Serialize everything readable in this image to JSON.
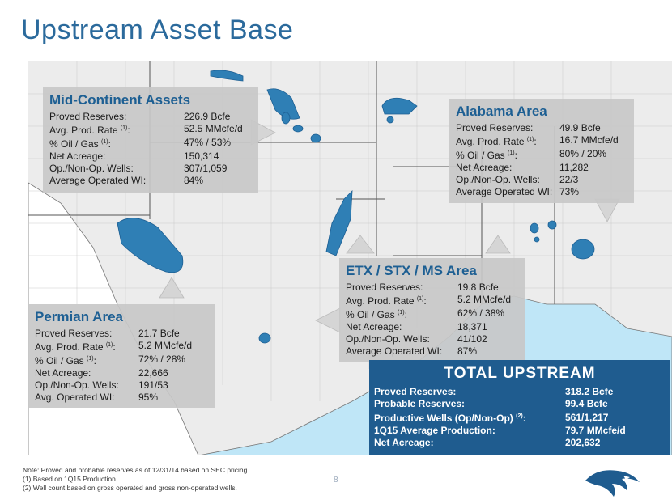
{
  "title": "Upstream Asset Base",
  "mid_continent": {
    "heading": "Mid-Continent Assets",
    "rows": [
      {
        "label": "Proved Reserves:",
        "sup": "",
        "value": "226.9 Bcfe"
      },
      {
        "label": "Avg. Prod. Rate ",
        "sup": "(1)",
        "suffix": ":",
        "value": "52.5 MMcfe/d"
      },
      {
        "label": "% Oil  / Gas ",
        "sup": "(1)",
        "suffix": ":",
        "value": "47% / 53%"
      },
      {
        "label": "Net Acreage:",
        "sup": "",
        "value": "150,314"
      },
      {
        "label": "Op./Non-Op. Wells:",
        "sup": "",
        "value": "307/1,059"
      },
      {
        "label": "Average Operated WI:",
        "sup": "",
        "value": "84%"
      }
    ]
  },
  "alabama": {
    "heading": "Alabama Area",
    "rows": [
      {
        "label": "Proved Reserves:",
        "sup": "",
        "value": "49.9 Bcfe"
      },
      {
        "label": "Avg. Prod. Rate ",
        "sup": "(1)",
        "suffix": ":",
        "value": "16.7 MMcfe/d"
      },
      {
        "label": "% Oil / Gas ",
        "sup": "(1)",
        "suffix": ":",
        "value": "80% / 20%"
      },
      {
        "label": "Net Acreage:",
        "sup": "",
        "value": "11,282"
      },
      {
        "label": "Op./Non-Op. Wells:",
        "sup": "",
        "value": "22/3"
      },
      {
        "label": "Average Operated WI:",
        "sup": "",
        "value": "73%"
      }
    ]
  },
  "etx": {
    "heading": "ETX / STX / MS Area",
    "rows": [
      {
        "label": "Proved Reserves:",
        "sup": "",
        "value": "19.8 Bcfe"
      },
      {
        "label": "Avg. Prod. Rate ",
        "sup": "(1)",
        "suffix": ":",
        "value": "5.2 MMcfe/d"
      },
      {
        "label": "% Oil / Gas ",
        "sup": "(1)",
        "suffix": ":",
        "value": "62% / 38%"
      },
      {
        "label": "Net Acreage:",
        "sup": "",
        "value": "18,371"
      },
      {
        "label": "Op./Non-Op. Wells:",
        "sup": "",
        "value": "41/102"
      },
      {
        "label": "Average Operated WI:",
        "sup": "",
        "value": "87%"
      }
    ]
  },
  "permian": {
    "heading": "Permian Area",
    "rows": [
      {
        "label": "Proved Reserves:",
        "sup": "",
        "value": "21.7 Bcfe"
      },
      {
        "label": "Avg. Prod. Rate ",
        "sup": "(1)",
        "suffix": ":",
        "value": "5.2 MMcfe/d"
      },
      {
        "label": "% Oil / Gas ",
        "sup": "(1)",
        "suffix": ":",
        "value": "72% / 28%"
      },
      {
        "label": "Net Acreage:",
        "sup": "",
        "value": "22,666"
      },
      {
        "label": "Op./Non-Op. Wells:",
        "sup": "",
        "value": "191/53"
      },
      {
        "label": "Avg. Operated WI:",
        "sup": "",
        "value": "95%"
      }
    ]
  },
  "total": {
    "heading": "TOTAL  UPSTREAM",
    "rows": [
      {
        "label": "Proved Reserves:",
        "sup": "",
        "value": "318.2 Bcfe"
      },
      {
        "label": "Probable Reserves:",
        "sup": "",
        "value": "99.4 Bcfe"
      },
      {
        "label": "Productive Wells (Op/Non-Op) ",
        "sup": "(2)",
        "suffix": ":",
        "value": "561/1,217"
      },
      {
        "label": "1Q15 Average Production:",
        "sup": "",
        "value": "79.7 MMcfe/d"
      },
      {
        "label": "Net Acreage:",
        "sup": "",
        "value": "202,632"
      }
    ]
  },
  "notes": [
    "Note:  Proved and probable reserves as of 12/31/14 based on SEC pricing.",
    "(1)     Based on 1Q15 Production.",
    "(2)     Well count based on gross operated and gross non-operated wells."
  ],
  "page_number": "8",
  "colors": {
    "title": "#2b6a9c",
    "asset": "#2f7fb5",
    "total_bg": "#1f5c8f",
    "water": "#bfe6f7"
  }
}
